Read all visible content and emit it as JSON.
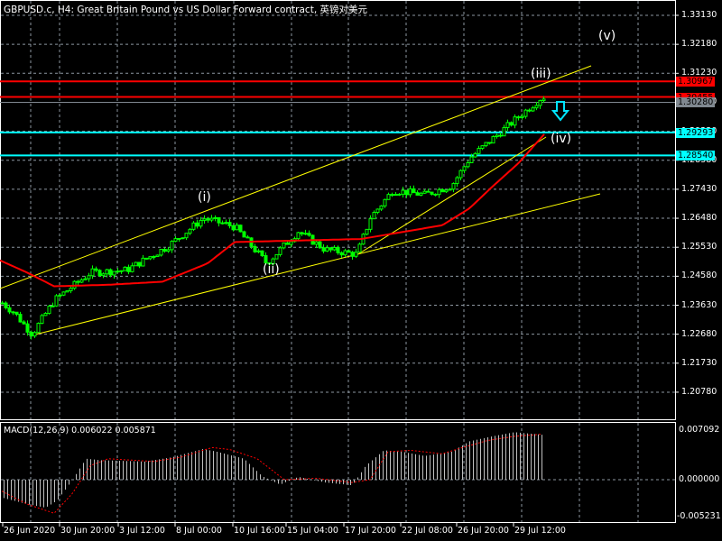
{
  "title": "GBPUSD.c, H4:  Great Britain Pound vs US Dollar Forward contract, 英镑对美元",
  "colors": {
    "bg": "#000000",
    "grid": "#8c96a0",
    "candle": "#00ff00",
    "ma": "#ff0000",
    "channel": "#ffff00",
    "hline_red": "#ff0000",
    "hline_cyan": "#00ffff",
    "hist": "#c0c0c0",
    "signal": "#ff0000"
  },
  "price_axis": [
    "1.33130",
    "1.32180",
    "1.31230",
    "1.30280",
    "1.29330",
    "1.28380",
    "1.27430",
    "1.26480",
    "1.25530",
    "1.24580",
    "1.23630",
    "1.22680",
    "1.21730",
    "1.20780"
  ],
  "price_levels": [
    1.3313,
    1.3218,
    1.3123,
    1.3028,
    1.2933,
    1.2838,
    1.2743,
    1.2648,
    1.2553,
    1.2458,
    1.2363,
    1.2268,
    1.2173,
    1.2078
  ],
  "hlines": [
    {
      "label": "1.30967",
      "price": 1.30967,
      "color": "#ff0000"
    },
    {
      "label": "1.30455",
      "price": 1.30455,
      "color": "#ff0000"
    },
    {
      "label": "1.30280",
      "price": 1.3028,
      "color": "#808890"
    },
    {
      "label": "1.29293",
      "price": 1.29293,
      "color": "#00ffff"
    },
    {
      "label": "1.28540",
      "price": 1.2854,
      "color": "#00ffff"
    }
  ],
  "waves": [
    "(i)",
    "(ii)",
    "(iii)",
    "(iv)",
    "(v)"
  ],
  "time_axis": [
    "26 Jun 2020",
    "30 Jun 20:00",
    "3 Jul 12:00",
    "8 Jul 00:00",
    "10 Jul 16:00",
    "15 Jul 04:00",
    "17 Jul 20:00",
    "22 Jul 08:00",
    "26 Jul 20:00",
    "29 Jul 12:00"
  ],
  "macd": {
    "label": "MACD(12,26,9) 0.006022 0.005871",
    "axis": [
      "0.007092",
      "0.000000",
      "-0.005231"
    ],
    "max": 0.007092,
    "min": -0.005231
  },
  "chart_data": {
    "type": "candlestick",
    "symbol": "GBPUSD.c",
    "timeframe": "H4",
    "price_path": [
      [
        0,
        1.2375
      ],
      [
        15,
        1.234
      ],
      [
        35,
        1.2268
      ],
      [
        60,
        1.238
      ],
      [
        100,
        1.247
      ],
      [
        140,
        1.2478
      ],
      [
        185,
        1.2555
      ],
      [
        225,
        1.2648
      ],
      [
        260,
        1.262
      ],
      [
        295,
        1.25
      ],
      [
        330,
        1.2605
      ],
      [
        360,
        1.2545
      ],
      [
        395,
        1.253
      ],
      [
        410,
        1.265
      ],
      [
        435,
        1.274
      ],
      [
        470,
        1.2725
      ],
      [
        500,
        1.2755
      ],
      [
        520,
        1.2845
      ],
      [
        550,
        1.292
      ],
      [
        580,
        1.2995
      ],
      [
        600,
        1.3045
      ]
    ],
    "ma_path": [
      [
        0,
        1.251
      ],
      [
        30,
        1.247
      ],
      [
        60,
        1.2425
      ],
      [
        120,
        1.243
      ],
      [
        180,
        1.244
      ],
      [
        230,
        1.25
      ],
      [
        260,
        1.257
      ],
      [
        330,
        1.2575
      ],
      [
        400,
        1.258
      ],
      [
        450,
        1.2605
      ],
      [
        490,
        1.2625
      ],
      [
        520,
        1.268
      ],
      [
        545,
        1.275
      ],
      [
        575,
        1.283
      ],
      [
        605,
        1.293
      ]
    ],
    "macd_hist_path": [
      [
        0,
        -0.0025
      ],
      [
        30,
        -0.0035
      ],
      [
        50,
        -0.004
      ],
      [
        63,
        -0.003
      ],
      [
        80,
        0.0
      ],
      [
        95,
        0.003
      ],
      [
        110,
        0.0028
      ],
      [
        160,
        0.0026
      ],
      [
        190,
        0.0032
      ],
      [
        225,
        0.0044
      ],
      [
        240,
        0.004
      ],
      [
        270,
        0.003
      ],
      [
        290,
        0.0005
      ],
      [
        310,
        -0.0007
      ],
      [
        330,
        0.0004
      ],
      [
        360,
        -0.0004
      ],
      [
        390,
        -0.0008
      ],
      [
        405,
        0.002
      ],
      [
        425,
        0.0042
      ],
      [
        445,
        0.004
      ],
      [
        470,
        0.0034
      ],
      [
        500,
        0.004
      ],
      [
        520,
        0.0055
      ],
      [
        545,
        0.0062
      ],
      [
        570,
        0.0068
      ],
      [
        603,
        0.0064
      ]
    ],
    "macd_signal_path": [
      [
        0,
        -0.0015
      ],
      [
        30,
        -0.0035
      ],
      [
        60,
        -0.0048
      ],
      [
        80,
        -0.002
      ],
      [
        100,
        0.002
      ],
      [
        120,
        0.003
      ],
      [
        170,
        0.0026
      ],
      [
        200,
        0.0032
      ],
      [
        235,
        0.0046
      ],
      [
        255,
        0.0043
      ],
      [
        285,
        0.003
      ],
      [
        315,
        0.0
      ],
      [
        350,
        0.0002
      ],
      [
        390,
        -0.0004
      ],
      [
        410,
        0.0
      ],
      [
        430,
        0.004
      ],
      [
        455,
        0.0042
      ],
      [
        490,
        0.0037
      ],
      [
        510,
        0.0045
      ],
      [
        540,
        0.0056
      ],
      [
        570,
        0.0062
      ],
      [
        600,
        0.0065
      ]
    ]
  }
}
